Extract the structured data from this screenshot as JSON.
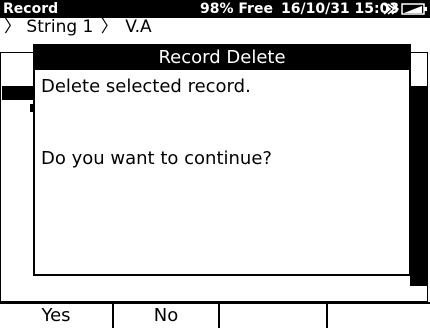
{
  "status_bar": {
    "title": "Record",
    "free": "98% Free",
    "datetime": "16/10/31 15:03",
    "icons": [
      "connection-icon",
      "battery-icon"
    ]
  },
  "breadcrumb": {
    "prefix": "〉",
    "items": [
      "String 1",
      "V.A"
    ]
  },
  "dialog": {
    "title": "Record Delete",
    "message": "Delete selected record.",
    "question": "Do you want to continue?"
  },
  "softkeys": [
    "Yes",
    "No",
    "",
    ""
  ]
}
